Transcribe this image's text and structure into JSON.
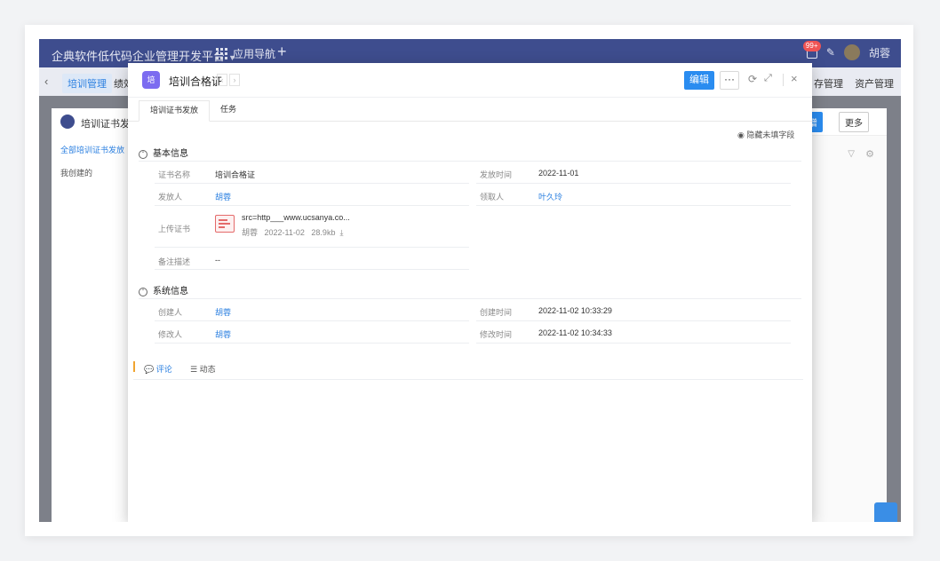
{
  "app": {
    "brand": "企典软件低代码企业管理开发平台",
    "app_nav": "应用导航",
    "notif_badge": "99+",
    "user_name": "胡蓉"
  },
  "tabbar": {
    "active_tab": "培训管理",
    "tab2": "绩效",
    "right_tabs": [
      "存管理",
      "资产管理"
    ]
  },
  "bg_panel": {
    "title": "培训证书发放",
    "side_all": "全部培训证书发放",
    "side_mine": "我创建的",
    "new_btn": "新增",
    "more_btn": "更多"
  },
  "modal": {
    "logo_text": "培",
    "title": "培训合格证",
    "edit_btn": "编辑",
    "more_dots": "···",
    "tabs": [
      "培训证书发放",
      "任务"
    ],
    "hide_fields": "隐藏未填字段",
    "basic": {
      "heading": "基本信息",
      "cert_name_label": "证书名称",
      "cert_name": "培训合格证",
      "issue_time_label": "发放时间",
      "issue_time": "2022-11-01",
      "issuer_label": "发放人",
      "issuer": "胡蓉",
      "receiver_label": "领取人",
      "receiver": "叶久玲",
      "upload_label": "上传证书",
      "file_name": "src=http___www.ucsanya.co...",
      "file_uploader": "胡蓉",
      "file_date": "2022-11-02",
      "file_size": "28.9kb",
      "remark_label": "备注描述",
      "remark": "--"
    },
    "system": {
      "heading": "系统信息",
      "creator_label": "创建人",
      "creator": "胡蓉",
      "create_time_label": "创建时间",
      "create_time": "2022-11-02 10:33:29",
      "modifier_label": "修改人",
      "modifier": "胡蓉",
      "modify_time_label": "修改时间",
      "modify_time": "2022-11-02 10:34:33"
    },
    "comment_tab": "评论",
    "activity_tab": "动态"
  },
  "colors": {
    "topbar": "#3e4d8e",
    "primary": "#2a8cf0",
    "link": "#2a7fe0",
    "accent_bar": "#f0a430"
  }
}
